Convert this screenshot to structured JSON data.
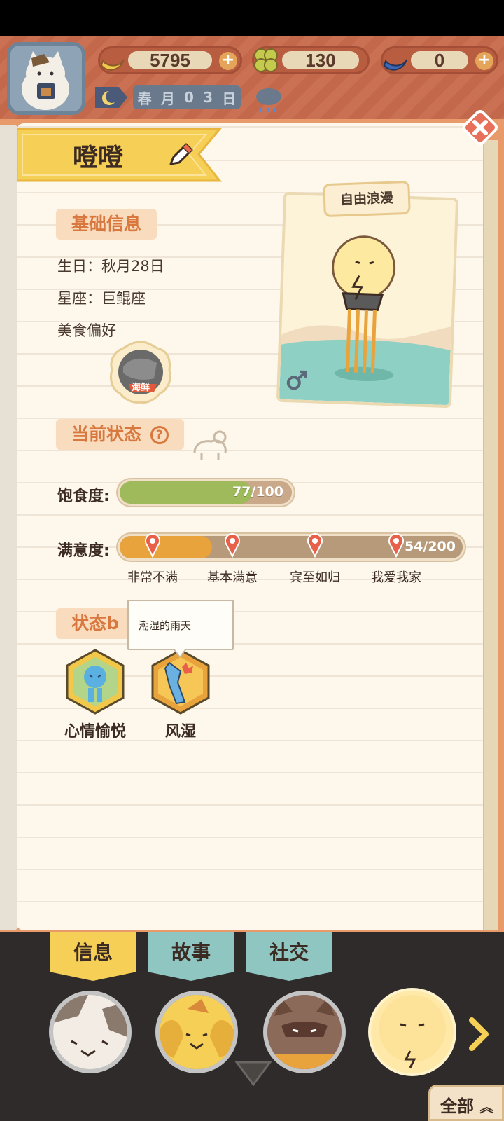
{
  "header": {
    "resources": [
      {
        "icon": "banana-icon",
        "value": "5795"
      },
      {
        "icon": "clover-icon",
        "value": "130"
      },
      {
        "icon": "blue-banana-icon",
        "value": "0"
      }
    ],
    "date": {
      "chars": [
        "春",
        "月",
        "0",
        "3",
        "日"
      ]
    },
    "weather_icon": "rain-cloud-icon"
  },
  "profile": {
    "name": "噔噔",
    "trait": "自由浪漫",
    "gender_icon": "male-icon"
  },
  "basic_info": {
    "title": "基础信息",
    "birthday": "生日：秋月28日",
    "zodiac": "星座：巨鲲座",
    "food_pref_label": "美食偏好",
    "food_pref_value": "海鲜"
  },
  "status": {
    "title": "当前状态",
    "hunger_label": "饱食度:",
    "hunger_value": 77,
    "hunger_max": 100,
    "hunger_text": "77/100",
    "satisfaction_label": "满意度:",
    "satisfaction_value": 54,
    "satisfaction_max": 200,
    "satisfaction_text": "54/200",
    "milestones": [
      "非常不满",
      "基本满意",
      "宾至如归",
      "我爱我家"
    ]
  },
  "buffs": {
    "title": "状态b",
    "tooltip": "潮湿的雨天",
    "items": [
      {
        "label": "心情愉悦",
        "icon": "happy-mood-icon"
      },
      {
        "label": "风湿",
        "icon": "rheumatism-icon"
      }
    ]
  },
  "tabs": [
    "信息",
    "故事",
    "社交"
  ],
  "bottom": {
    "all_label": "全部"
  },
  "colors": {
    "accent": "#d8773e",
    "hunger_fill": "#9fba5a",
    "satisfaction_fill": "#e9a33d",
    "tab_active": "#f6cf57",
    "tab_inactive": "#8fc6c2"
  }
}
